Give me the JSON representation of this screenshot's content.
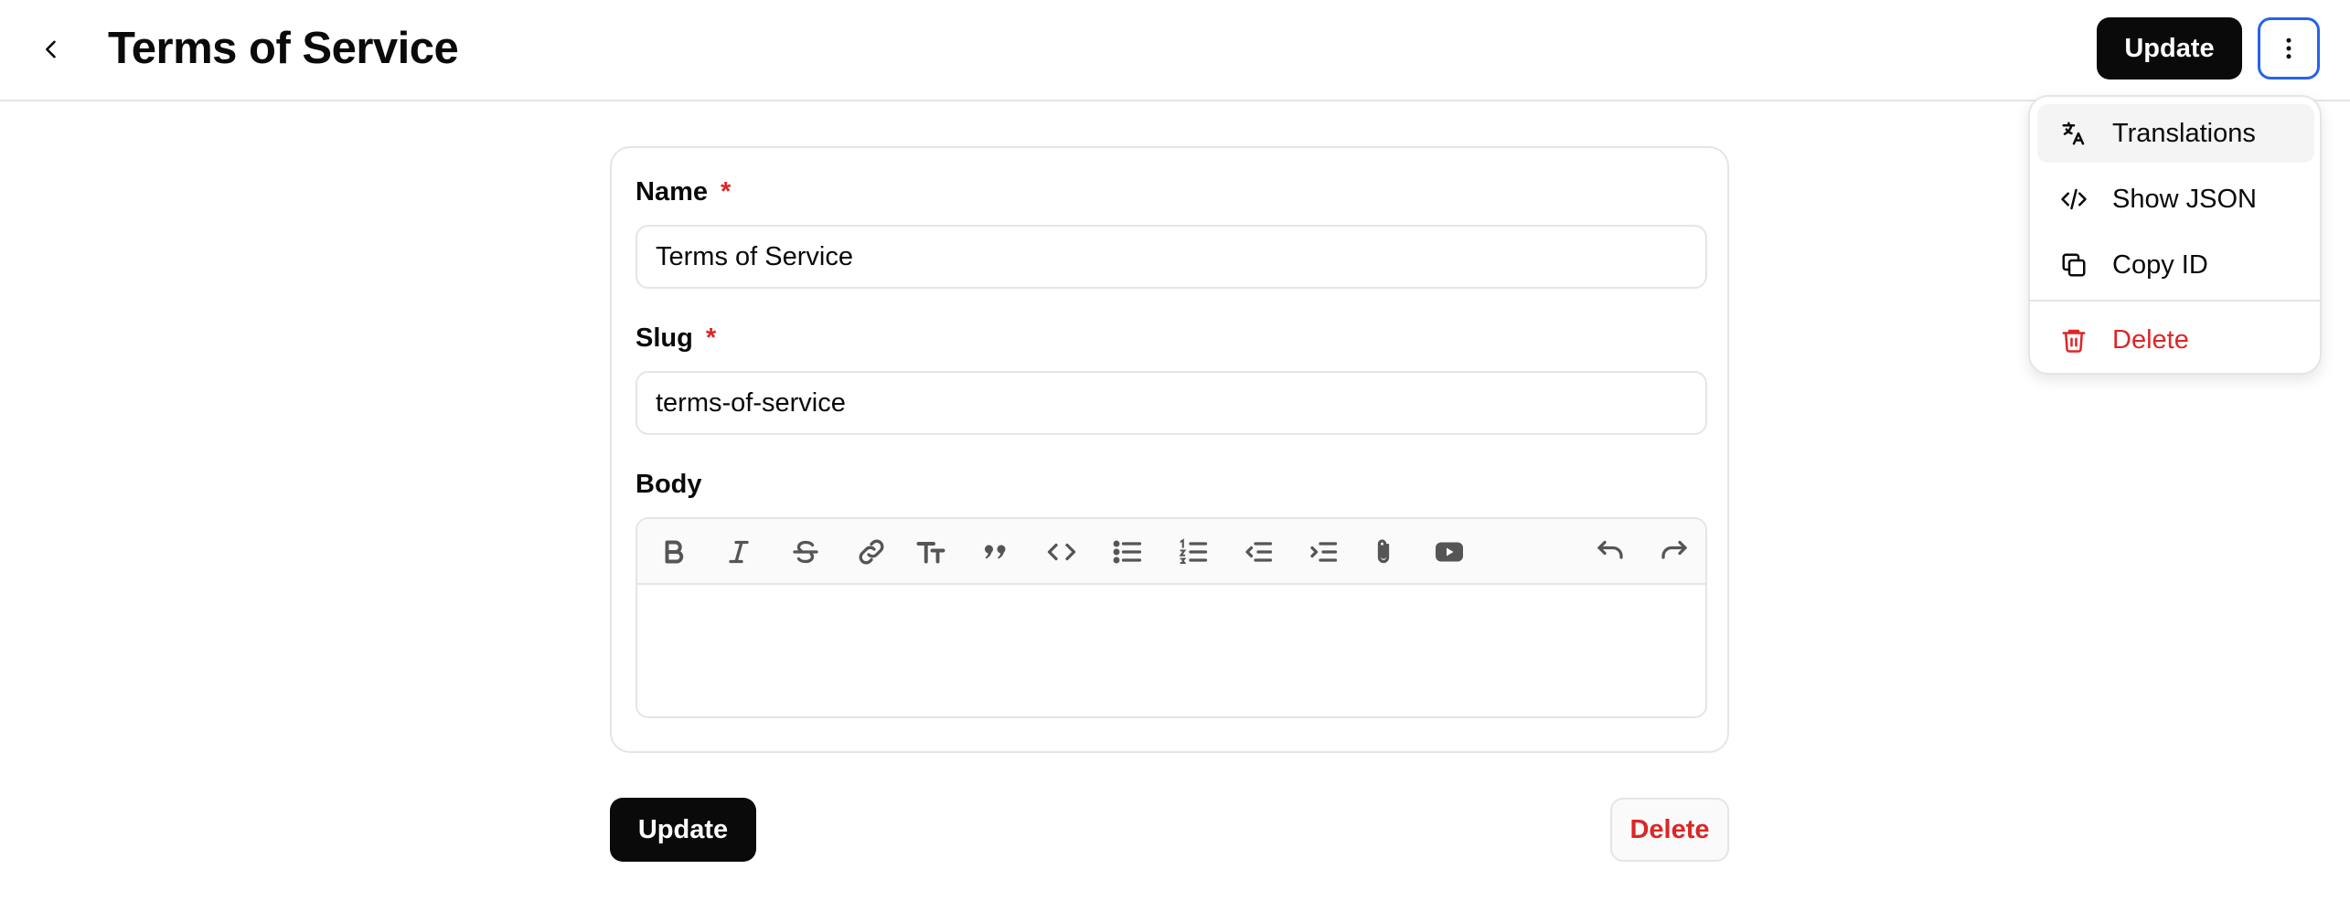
{
  "header": {
    "title": "Terms of Service",
    "update_label": "Update"
  },
  "form": {
    "name": {
      "label": "Name",
      "required_mark": "*",
      "value": "Terms of Service"
    },
    "slug": {
      "label": "Slug",
      "required_mark": "*",
      "value": "terms-of-service"
    },
    "body": {
      "label": "Body",
      "value": ""
    }
  },
  "toolbar": {
    "icons": [
      "bold-icon",
      "italic-icon",
      "strikethrough-icon",
      "link-icon",
      "heading-icon",
      "quote-icon",
      "code-icon",
      "bullet-list-icon",
      "numbered-list-icon",
      "outdent-icon",
      "indent-icon",
      "attachment-icon",
      "youtube-icon",
      "undo-icon",
      "redo-icon"
    ]
  },
  "actions": {
    "update_label": "Update",
    "delete_label": "Delete"
  },
  "menu": {
    "items": [
      {
        "label": "Translations",
        "icon": "translate-icon"
      },
      {
        "label": "Show JSON",
        "icon": "code-icon"
      },
      {
        "label": "Copy ID",
        "icon": "copy-icon"
      },
      {
        "label": "Delete",
        "icon": "trash-icon"
      }
    ]
  },
  "colors": {
    "primary": "#0a0a0a",
    "danger": "#dc2626",
    "focus_ring": "#2563eb",
    "border": "#e5e5e5"
  }
}
